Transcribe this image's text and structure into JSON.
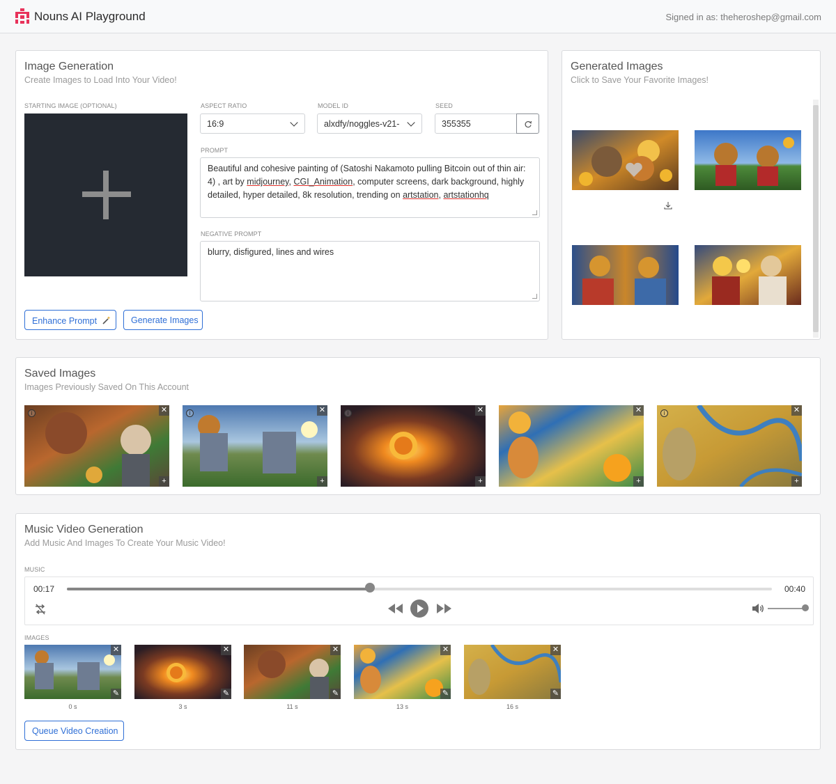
{
  "header": {
    "title": "Nouns AI Playground",
    "signed_in": "Signed in as: theheroshep@gmail.com"
  },
  "image_generation": {
    "title": "Image Generation",
    "subtitle": "Create Images to Load Into Your Video!",
    "starting_image_label": "STARTING IMAGE (OPTIONAL)",
    "aspect_ratio_label": "ASPECT RATIO",
    "aspect_ratio_value": "16:9",
    "model_id_label": "MODEL ID",
    "model_id_value": "alxdfy/noggles-v21-",
    "seed_label": "SEED",
    "seed_value": "355355",
    "prompt_label": "PROMPT",
    "prompt_parts": [
      "Beautiful and cohesive painting of (Satoshi Nakamoto pulling Bitcoin out of thin air: 4) , art by ",
      "midjourney",
      ", ",
      "CGI_Animation",
      ", computer screens, dark background, highly detailed, hyper detailed, 8k resolution, trending on ",
      "artstation",
      ", ",
      "artstationhq"
    ],
    "negative_prompt_label": "NEGATIVE PROMPT",
    "negative_prompt_value": "blurry, disfigured, lines and wires",
    "enhance_button": "Enhance Prompt",
    "generate_button": "Generate Images"
  },
  "generated_images": {
    "title": "Generated Images",
    "subtitle": "Click to Save Your Favorite Images!"
  },
  "saved_images": {
    "title": "Saved Images",
    "subtitle": "Images Previously Saved On This Account"
  },
  "music_video": {
    "title": "Music Video Generation",
    "subtitle": "Add Music And Images To Create Your Music Video!",
    "music_label": "MUSIC",
    "current_time": "00:17",
    "total_time": "00:40",
    "progress_fraction": 0.43,
    "volume_fraction": 1.0,
    "images_label": "IMAGES",
    "image_times": [
      "0 s",
      "3 s",
      "11 s",
      "13 s",
      "16 s"
    ],
    "queue_button": "Queue Video Creation"
  },
  "colors": {
    "accent": "#2f6fd6",
    "brand": "#e8325a"
  },
  "icons": [
    "nouns-logo-icon",
    "chevron-down-icon",
    "refresh-icon",
    "magic-wand-icon",
    "heart-icon",
    "download-icon",
    "info-icon",
    "close-icon",
    "plus-icon",
    "shuffle-icon",
    "rewind-icon",
    "play-icon",
    "fast-forward-icon",
    "volume-icon",
    "pencil-icon"
  ]
}
